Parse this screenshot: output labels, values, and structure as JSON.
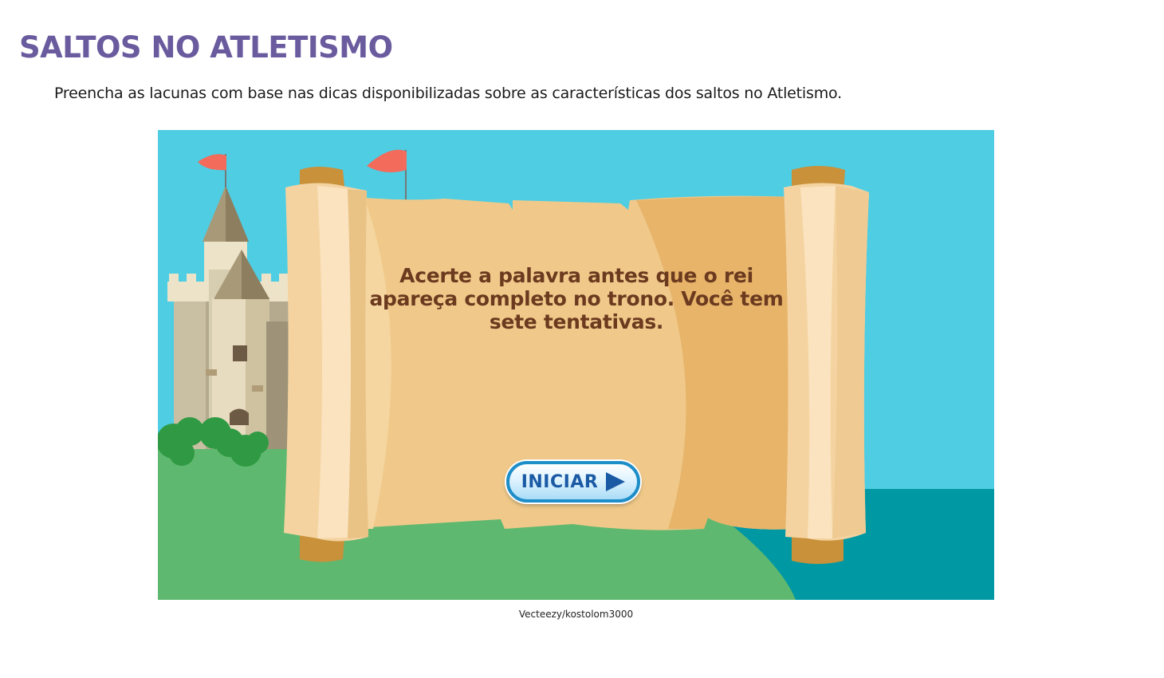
{
  "page": {
    "title": "SALTOS NO ATLETISMO",
    "instructions": "Preencha as lacunas com base nas dicas disponibilizadas sobre as características dos saltos no Atletismo."
  },
  "game": {
    "message_lines": [
      "Acerte a palavra antes que o rei",
      "apareça completo no trono. Você tem",
      "sete tentativas."
    ],
    "start_button_label": "INICIAR",
    "start_button_icon": "play-arrow-icon",
    "image_credit": "Vecteezy/kostolom3000"
  },
  "colors": {
    "title": "#6a5a9e",
    "sky": "#4ecde3",
    "grass": "#5fb86f",
    "sea": "#0099a3",
    "parchment": "#f0c98a",
    "message_text": "#6b3a1f",
    "button_border": "#1e8ec9",
    "button_text": "#1a5aa5",
    "flag": "#f26b5b"
  }
}
